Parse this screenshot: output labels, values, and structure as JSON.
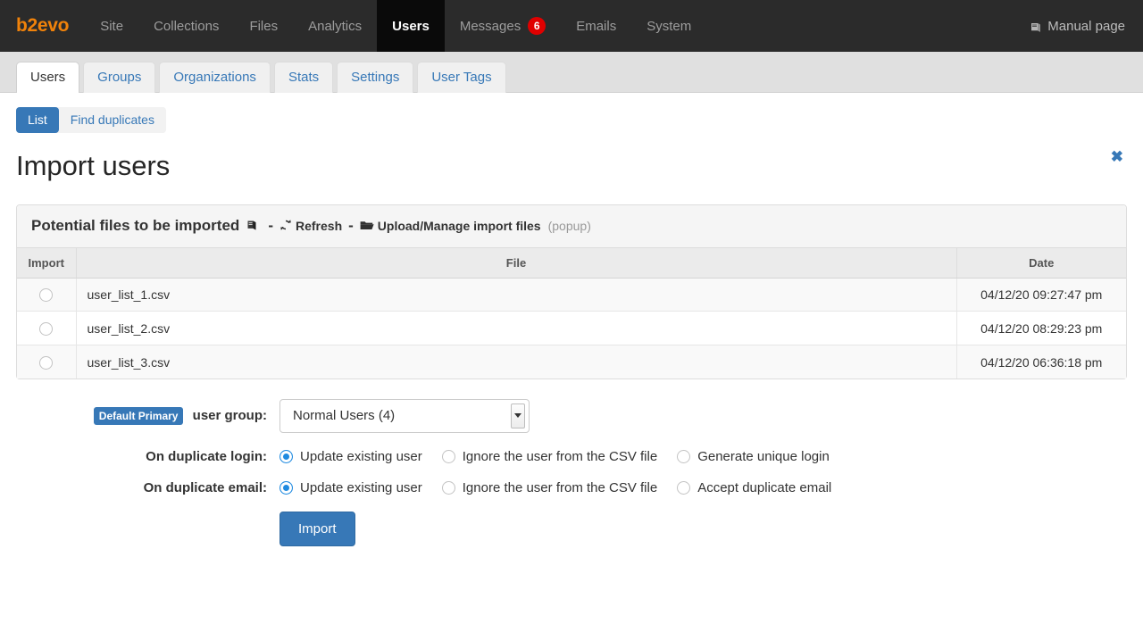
{
  "navbar": {
    "brand": "b2evo",
    "items": [
      {
        "label": "Site",
        "active": false
      },
      {
        "label": "Collections",
        "active": false
      },
      {
        "label": "Files",
        "active": false
      },
      {
        "label": "Analytics",
        "active": false
      },
      {
        "label": "Users",
        "active": true
      },
      {
        "label": "Messages",
        "active": false,
        "badge": "6"
      },
      {
        "label": "Emails",
        "active": false
      },
      {
        "label": "System",
        "active": false
      }
    ],
    "manual_label": "Manual page",
    "manual_icon": "book-icon",
    "badge_color": "#e00000",
    "brand_color": "#f0820a"
  },
  "tabs": [
    {
      "label": "Users",
      "active": true
    },
    {
      "label": "Groups",
      "active": false
    },
    {
      "label": "Organizations",
      "active": false
    },
    {
      "label": "Stats",
      "active": false
    },
    {
      "label": "Settings",
      "active": false
    },
    {
      "label": "User Tags",
      "active": false
    }
  ],
  "subnav": [
    {
      "label": "List",
      "active": true
    },
    {
      "label": "Find duplicates",
      "active": false
    }
  ],
  "page": {
    "title": "Import users",
    "close_icon": "close-icon"
  },
  "panel": {
    "heading": "Potential files to be imported",
    "heading_icon": "book-icon",
    "separator": "-",
    "refresh_label": "Refresh",
    "refresh_icon": "refresh-icon",
    "upload_label": "Upload/Manage import files",
    "upload_icon": "folder-open-icon",
    "popup_note": "(popup)"
  },
  "table": {
    "columns": [
      "Import",
      "File",
      "Date"
    ],
    "rows": [
      {
        "selected": false,
        "file": "user_list_1.csv",
        "date": "04/12/20 09:27:47 pm"
      },
      {
        "selected": false,
        "file": "user_list_2.csv",
        "date": "04/12/20 08:29:23 pm"
      },
      {
        "selected": false,
        "file": "user_list_3.csv",
        "date": "04/12/20 06:36:18 pm"
      }
    ]
  },
  "form": {
    "group_badge": "Default Primary",
    "group_label": "user group:",
    "group_value": "Normal Users (4)",
    "duplicate_login": {
      "label": "On duplicate login:",
      "options": [
        {
          "label": "Update existing user",
          "selected": true
        },
        {
          "label": "Ignore the user from the CSV file",
          "selected": false
        },
        {
          "label": "Generate unique login",
          "selected": false
        }
      ]
    },
    "duplicate_email": {
      "label": "On duplicate email:",
      "options": [
        {
          "label": "Update existing user",
          "selected": true
        },
        {
          "label": "Ignore the user from the CSV file",
          "selected": false
        },
        {
          "label": "Accept duplicate email",
          "selected": false
        }
      ]
    },
    "submit_label": "Import",
    "accent_color": "#3778b7"
  }
}
